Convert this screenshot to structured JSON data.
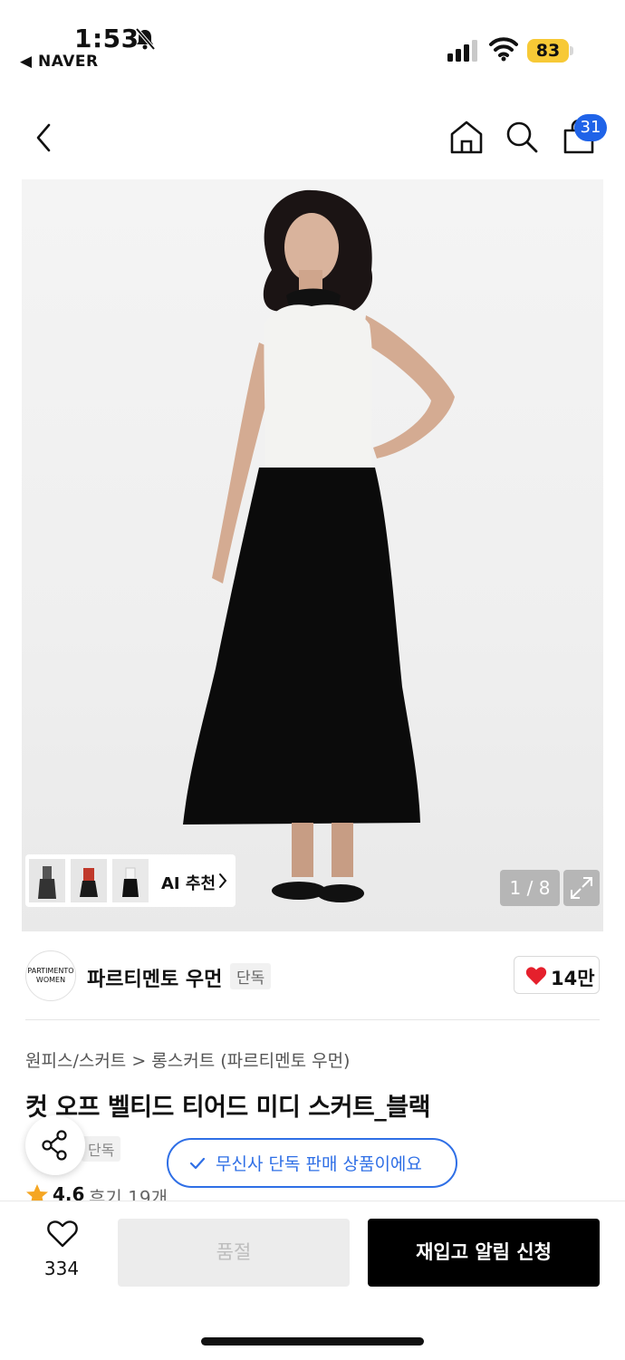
{
  "status_bar": {
    "time": "1:53",
    "back_app": "◀ NAVER",
    "battery": "83"
  },
  "nav": {
    "cart_count": "31"
  },
  "gallery": {
    "ai_label": "AI 추천",
    "counter": "1 / 8"
  },
  "brand": {
    "logo_line1": "PARTIMENTO",
    "logo_line2": "WOMEN",
    "name": "파르티멘토 우먼",
    "tag": "단독",
    "like_count": "14만"
  },
  "product": {
    "breadcrumb": "원피스/스커트  >  롱스커트 (파르티멘토 우먼)",
    "title": "컷 오프 벨티드 티어드 미디 스커트_블랙",
    "exclusive_tag": "단독",
    "notice": "무신사 단독 판매 상품이에요",
    "rating": "4.6",
    "review_count": "후기 19개"
  },
  "bottom": {
    "wish_count": "334",
    "soldout_label": "품절",
    "restock_label": "재입고 알림 신청"
  },
  "colors": {
    "accent_blue": "#2f6fe6",
    "badge_blue": "#1f63e8",
    "heart_red": "#e5202c",
    "battery_yellow": "#f7c936"
  }
}
